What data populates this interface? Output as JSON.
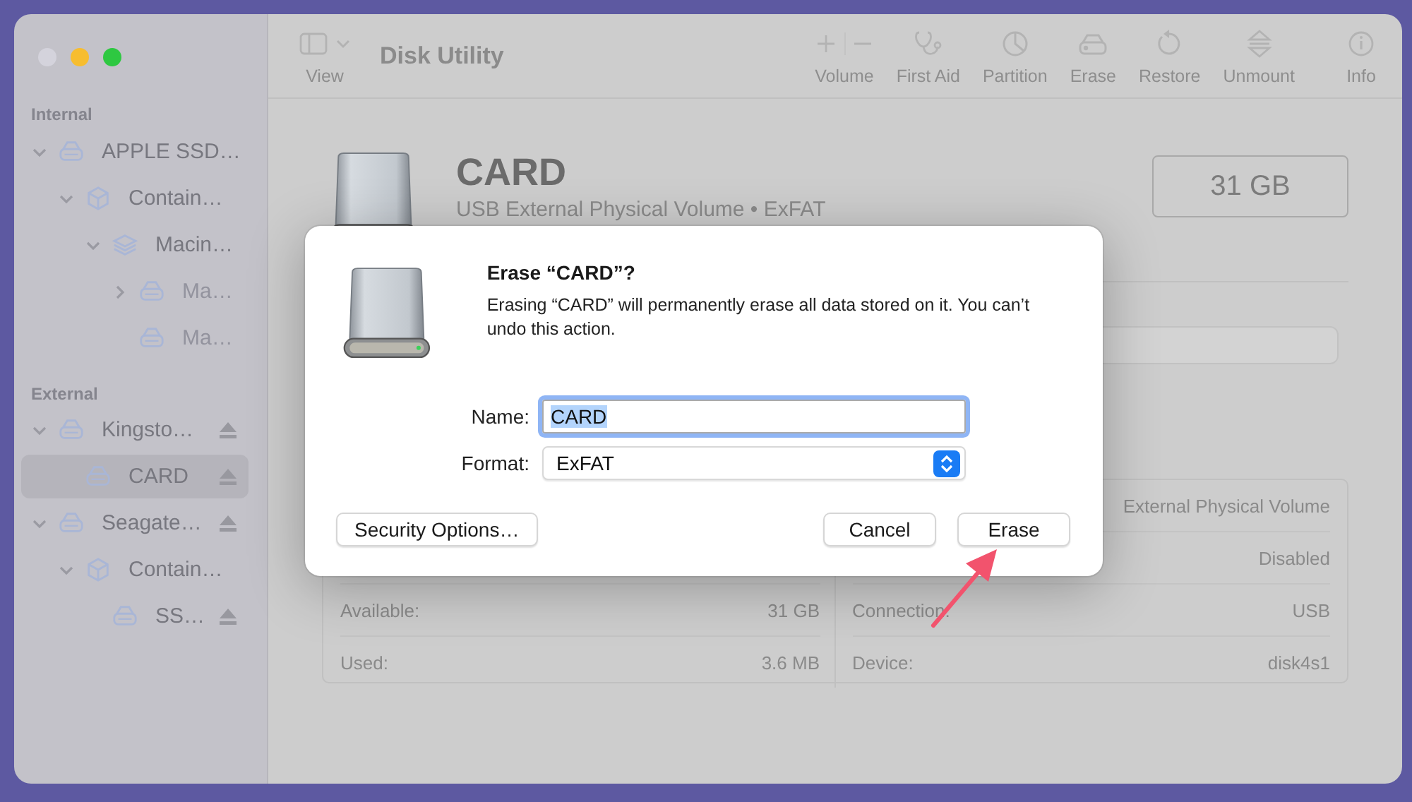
{
  "window": {
    "title": "Disk Utility",
    "traffic_lights": [
      {
        "color": "#d4d3dc"
      },
      {
        "color": "#f7bd2f"
      },
      {
        "color": "#2ec841"
      }
    ]
  },
  "toolbar": {
    "view": {
      "label": "View"
    },
    "items": [
      {
        "kind": "volume",
        "label": "Volume"
      },
      {
        "kind": "first-aid",
        "label": "First Aid"
      },
      {
        "kind": "partition",
        "label": "Partition"
      },
      {
        "kind": "erase",
        "label": "Erase"
      },
      {
        "kind": "restore",
        "label": "Restore"
      },
      {
        "kind": "unmount",
        "label": "Unmount"
      },
      {
        "kind": "info",
        "label": "Info"
      }
    ]
  },
  "sidebar": {
    "sections": [
      {
        "heading": "Internal",
        "items": [
          {
            "label": "APPLE SSD…",
            "kind": "disk",
            "selected": false,
            "dimmed": false,
            "ejectable": false,
            "expanded": true,
            "children": [
              {
                "label": "Contain…",
                "kind": "container",
                "selected": false,
                "dimmed": false,
                "ejectable": false,
                "expanded": true,
                "children": [
                  {
                    "label": "Macin…",
                    "kind": "stack",
                    "selected": false,
                    "dimmed": false,
                    "ejectable": false,
                    "expanded": true,
                    "children": [
                      {
                        "label": "Ma…",
                        "kind": "disk",
                        "selected": false,
                        "dimmed": true,
                        "ejectable": false,
                        "expanded": false
                      },
                      {
                        "label": "Ma…",
                        "kind": "disk",
                        "selected": false,
                        "dimmed": true,
                        "ejectable": false
                      }
                    ]
                  }
                ]
              }
            ]
          }
        ]
      },
      {
        "heading": "External",
        "items": [
          {
            "label": "Kingsto…",
            "kind": "disk",
            "selected": false,
            "dimmed": false,
            "ejectable": true,
            "expanded": true,
            "children": [
              {
                "label": "CARD",
                "kind": "disk",
                "selected": true,
                "dimmed": false,
                "ejectable": true
              }
            ]
          },
          {
            "label": "Seagate…",
            "kind": "disk",
            "selected": false,
            "dimmed": false,
            "ejectable": true,
            "expanded": true,
            "children": [
              {
                "label": "Contain…",
                "kind": "container",
                "selected": false,
                "dimmed": false,
                "ejectable": false,
                "expanded": true,
                "children": [
                  {
                    "label": "SS…",
                    "kind": "disk",
                    "selected": false,
                    "dimmed": false,
                    "ejectable": true
                  }
                ]
              }
            ]
          }
        ]
      }
    ]
  },
  "detail": {
    "title": "CARD",
    "subtitle": "USB External Physical Volume • ExFAT",
    "capacity": "31 GB",
    "info_rows": [
      {
        "right_value": "External Physical Volume"
      },
      {
        "right_value": "Disabled"
      },
      {
        "left_label": "Available:",
        "left_value": "31 GB",
        "right_label": "Connection:",
        "right_value": "USB"
      },
      {
        "left_label": "Used:",
        "left_value": "3.6 MB",
        "right_label": "Device:",
        "right_value": "disk4s1"
      }
    ]
  },
  "sheet": {
    "title": "Erase “CARD”?",
    "message": "Erasing “CARD” will permanently erase all data stored on it. You can’t undo this action.",
    "fields": [
      {
        "kind": "text",
        "label": "Name:",
        "value": "CARD",
        "text_selected": true
      },
      {
        "kind": "popup",
        "label": "Format:",
        "value": "ExFAT"
      }
    ],
    "left_buttons": [
      {
        "label": "Security Options…"
      }
    ],
    "right_buttons": [
      {
        "label": "Cancel"
      },
      {
        "label": "Erase"
      }
    ]
  }
}
